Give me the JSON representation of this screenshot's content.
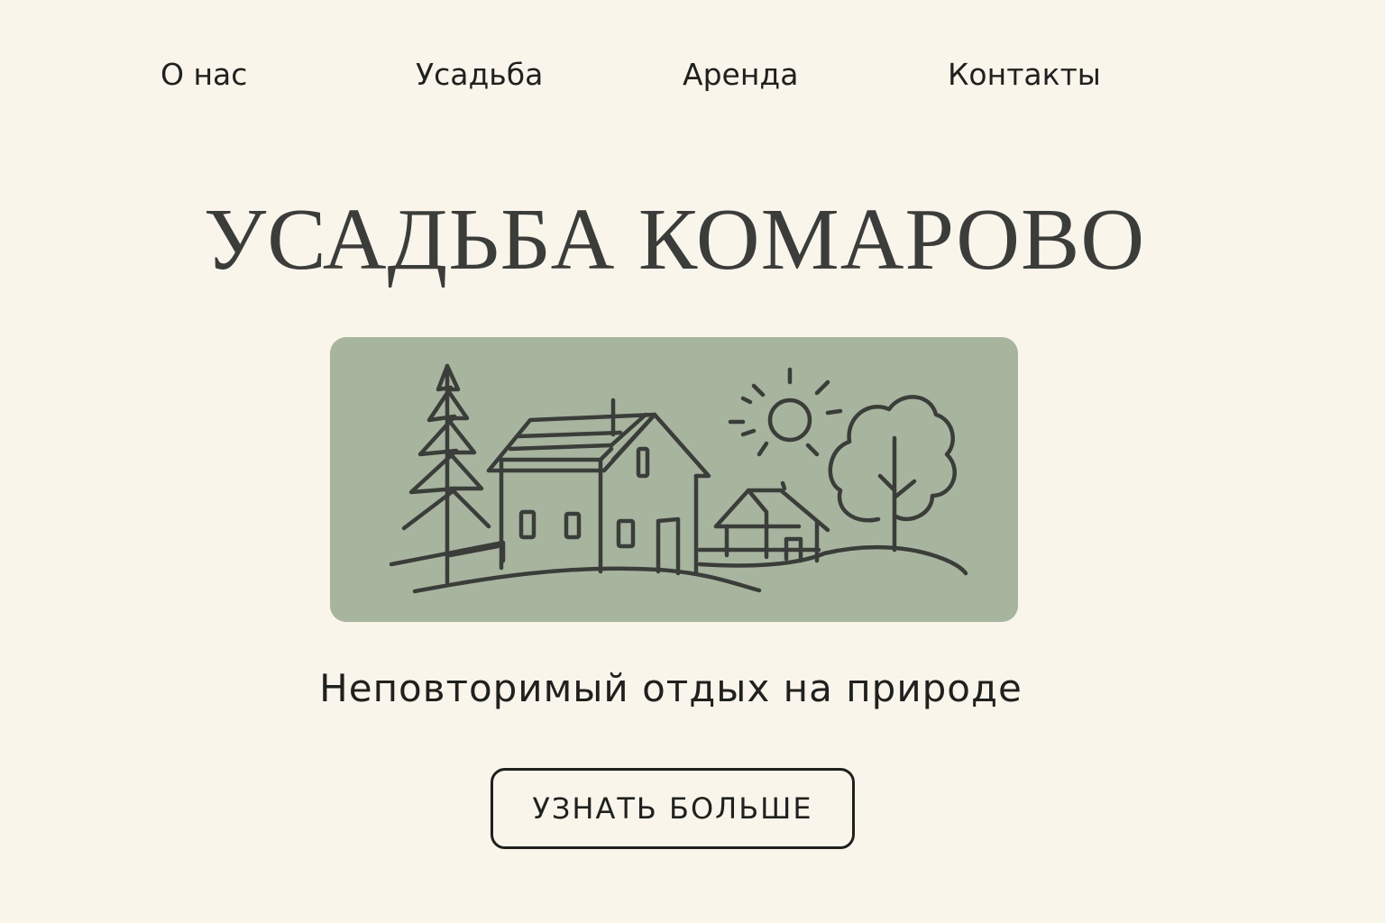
{
  "nav": {
    "items": [
      {
        "label": "О нас"
      },
      {
        "label": "Усадьба"
      },
      {
        "label": "Аренда"
      },
      {
        "label": "Контакты"
      }
    ]
  },
  "hero": {
    "title": "УСАДЬБА КОМАРОВО",
    "illustration": {
      "icon": "estate-house-landscape-illustration",
      "background_color": "#A8B59E",
      "line_color": "#3a3d39"
    },
    "tagline": "Неповторимый отдых на природе",
    "cta_label": "УЗНАТЬ БОЛЬШЕ"
  },
  "colors": {
    "page_background": "#FAF5EA",
    "text": "#1f211f"
  }
}
